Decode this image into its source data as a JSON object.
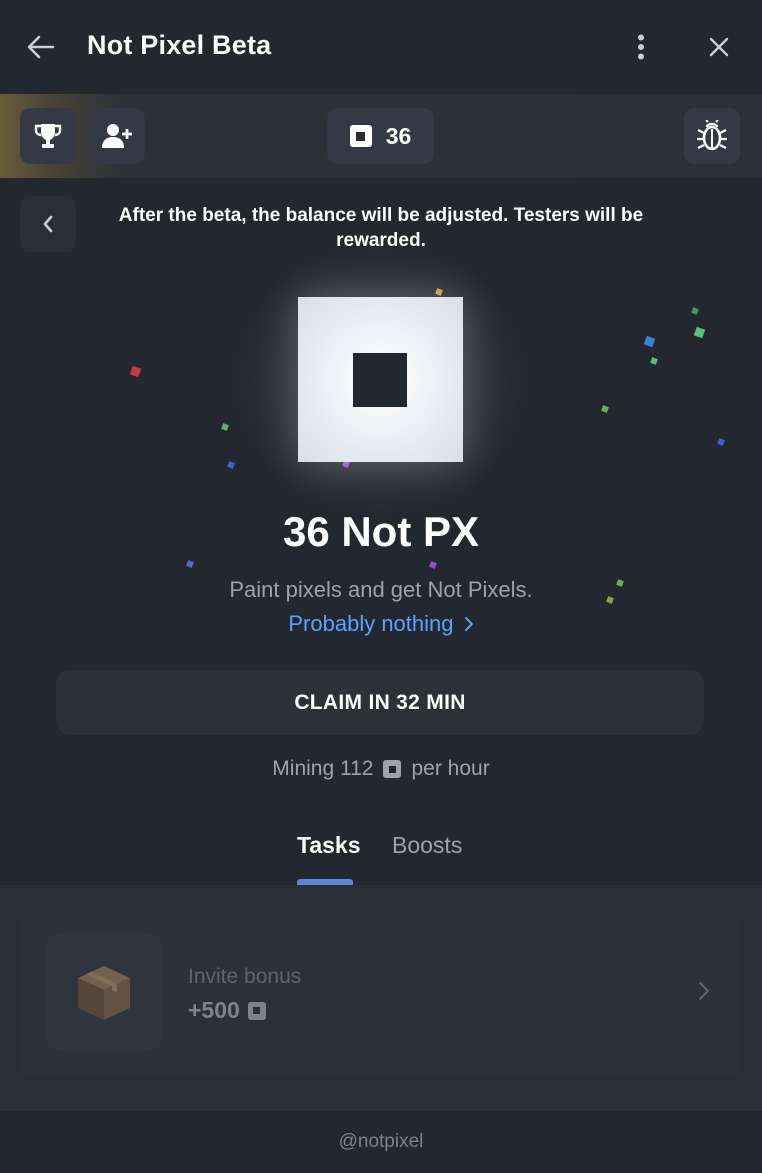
{
  "window": {
    "title": "Not Pixel Beta",
    "back_icon": "arrow-left-icon",
    "menu_icon": "more-vertical-icon",
    "close_icon": "close-icon"
  },
  "toolbar": {
    "trophy_icon": "trophy-icon",
    "invite_icon": "user-plus-icon",
    "balance": "36",
    "balance_icon": "pixel-icon",
    "bug_icon": "bug-icon"
  },
  "main": {
    "beta_back_icon": "chevron-left-icon",
    "beta_notice": "After the beta, the balance will be adjusted. Testers will be rewarded.",
    "balance_text": "36 Not PX",
    "subtitle": "Paint pixels and get Not Pixels.",
    "link_text": "Probably nothing",
    "claim_button": "CLAIM IN 32 MIN",
    "mining_prefix": "Mining 112",
    "mining_suffix": "per hour"
  },
  "tabs": [
    {
      "label": "Tasks",
      "active": true
    },
    {
      "label": "Boosts",
      "active": false
    }
  ],
  "tasks": [
    {
      "title": "Invite bonus",
      "reward": "+500",
      "icon": "box-icon"
    }
  ],
  "footer": {
    "handle": "@notpixel"
  },
  "colors": {
    "background": "#232730",
    "link": "#5aa2ff",
    "tab_indicator": "#5b86d8"
  }
}
